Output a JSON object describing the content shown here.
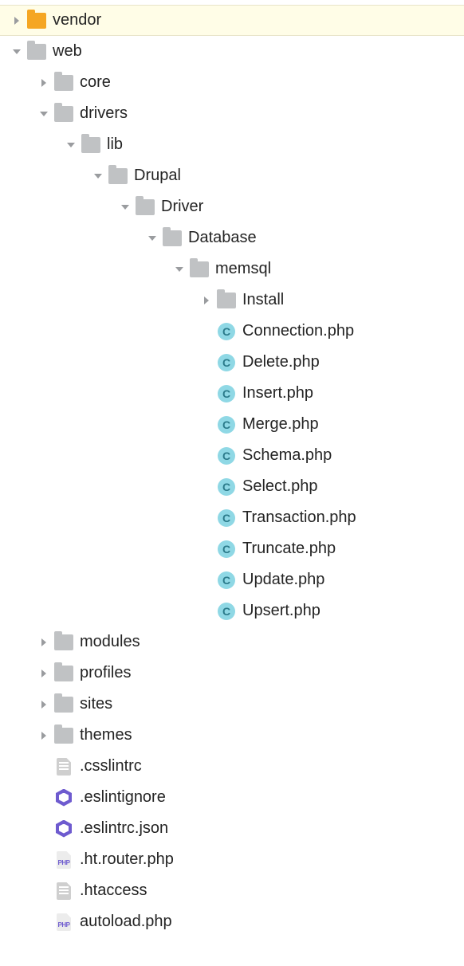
{
  "colors": {
    "highlight_bg": "#FFFDE7",
    "folder_orange": "#F5A623",
    "folder_grey": "#C0C2C4",
    "class_circle": "#8FD8E5",
    "eslint_hex": "#6E5BCF"
  },
  "nodes": [
    {
      "label": "vendor",
      "level": 0,
      "arrow": "right",
      "icon": "folder-orange",
      "highlight": true
    },
    {
      "label": "web",
      "level": 0,
      "arrow": "down",
      "icon": "folder-grey"
    },
    {
      "label": "core",
      "level": 1,
      "arrow": "right",
      "icon": "folder-grey"
    },
    {
      "label": "drivers",
      "level": 1,
      "arrow": "down",
      "icon": "folder-grey"
    },
    {
      "label": "lib",
      "level": 2,
      "arrow": "down",
      "icon": "folder-grey"
    },
    {
      "label": "Drupal",
      "level": 3,
      "arrow": "down",
      "icon": "folder-grey"
    },
    {
      "label": "Driver",
      "level": 4,
      "arrow": "down",
      "icon": "folder-grey"
    },
    {
      "label": "Database",
      "level": 5,
      "arrow": "down",
      "icon": "folder-grey"
    },
    {
      "label": "memsql",
      "level": 6,
      "arrow": "down",
      "icon": "folder-grey"
    },
    {
      "label": "Install",
      "level": 7,
      "arrow": "right",
      "icon": "folder-grey"
    },
    {
      "label": "Connection.php",
      "level": 7,
      "arrow": "none",
      "icon": "class-c"
    },
    {
      "label": "Delete.php",
      "level": 7,
      "arrow": "none",
      "icon": "class-c"
    },
    {
      "label": "Insert.php",
      "level": 7,
      "arrow": "none",
      "icon": "class-c"
    },
    {
      "label": "Merge.php",
      "level": 7,
      "arrow": "none",
      "icon": "class-c"
    },
    {
      "label": "Schema.php",
      "level": 7,
      "arrow": "none",
      "icon": "class-c"
    },
    {
      "label": "Select.php",
      "level": 7,
      "arrow": "none",
      "icon": "class-c"
    },
    {
      "label": "Transaction.php",
      "level": 7,
      "arrow": "none",
      "icon": "class-c"
    },
    {
      "label": "Truncate.php",
      "level": 7,
      "arrow": "none",
      "icon": "class-c"
    },
    {
      "label": "Update.php",
      "level": 7,
      "arrow": "none",
      "icon": "class-c"
    },
    {
      "label": "Upsert.php",
      "level": 7,
      "arrow": "none",
      "icon": "class-c"
    },
    {
      "label": "modules",
      "level": 1,
      "arrow": "right",
      "icon": "folder-grey"
    },
    {
      "label": "profiles",
      "level": 1,
      "arrow": "right",
      "icon": "folder-grey"
    },
    {
      "label": "sites",
      "level": 1,
      "arrow": "right",
      "icon": "folder-grey"
    },
    {
      "label": "themes",
      "level": 1,
      "arrow": "right",
      "icon": "folder-grey"
    },
    {
      "label": ".csslintrc",
      "level": 1,
      "arrow": "none",
      "icon": "config"
    },
    {
      "label": ".eslintignore",
      "level": 1,
      "arrow": "none",
      "icon": "eslint"
    },
    {
      "label": ".eslintrc.json",
      "level": 1,
      "arrow": "none",
      "icon": "eslint"
    },
    {
      "label": ".ht.router.php",
      "level": 1,
      "arrow": "none",
      "icon": "php"
    },
    {
      "label": ".htaccess",
      "level": 1,
      "arrow": "none",
      "icon": "config"
    },
    {
      "label": "autoload.php",
      "level": 1,
      "arrow": "none",
      "icon": "php"
    }
  ],
  "glyphs": {
    "class_letter": "C",
    "php_label": "PHP"
  }
}
